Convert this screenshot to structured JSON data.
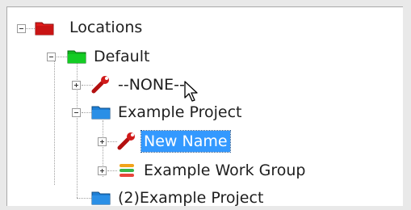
{
  "tree": {
    "locations_label": "Locations",
    "default_label": "Default",
    "none_label": "--NONE--",
    "example_project_label": "Example Project",
    "new_name_label": "New Name",
    "work_group_label": "Example Work Group",
    "example_project_2_label": "(2)Example Project"
  },
  "colors": {
    "folder_red": "#e01b1b",
    "folder_green": "#10b81e",
    "folder_blue": "#1e7fd6",
    "selection": "#3399ff"
  }
}
